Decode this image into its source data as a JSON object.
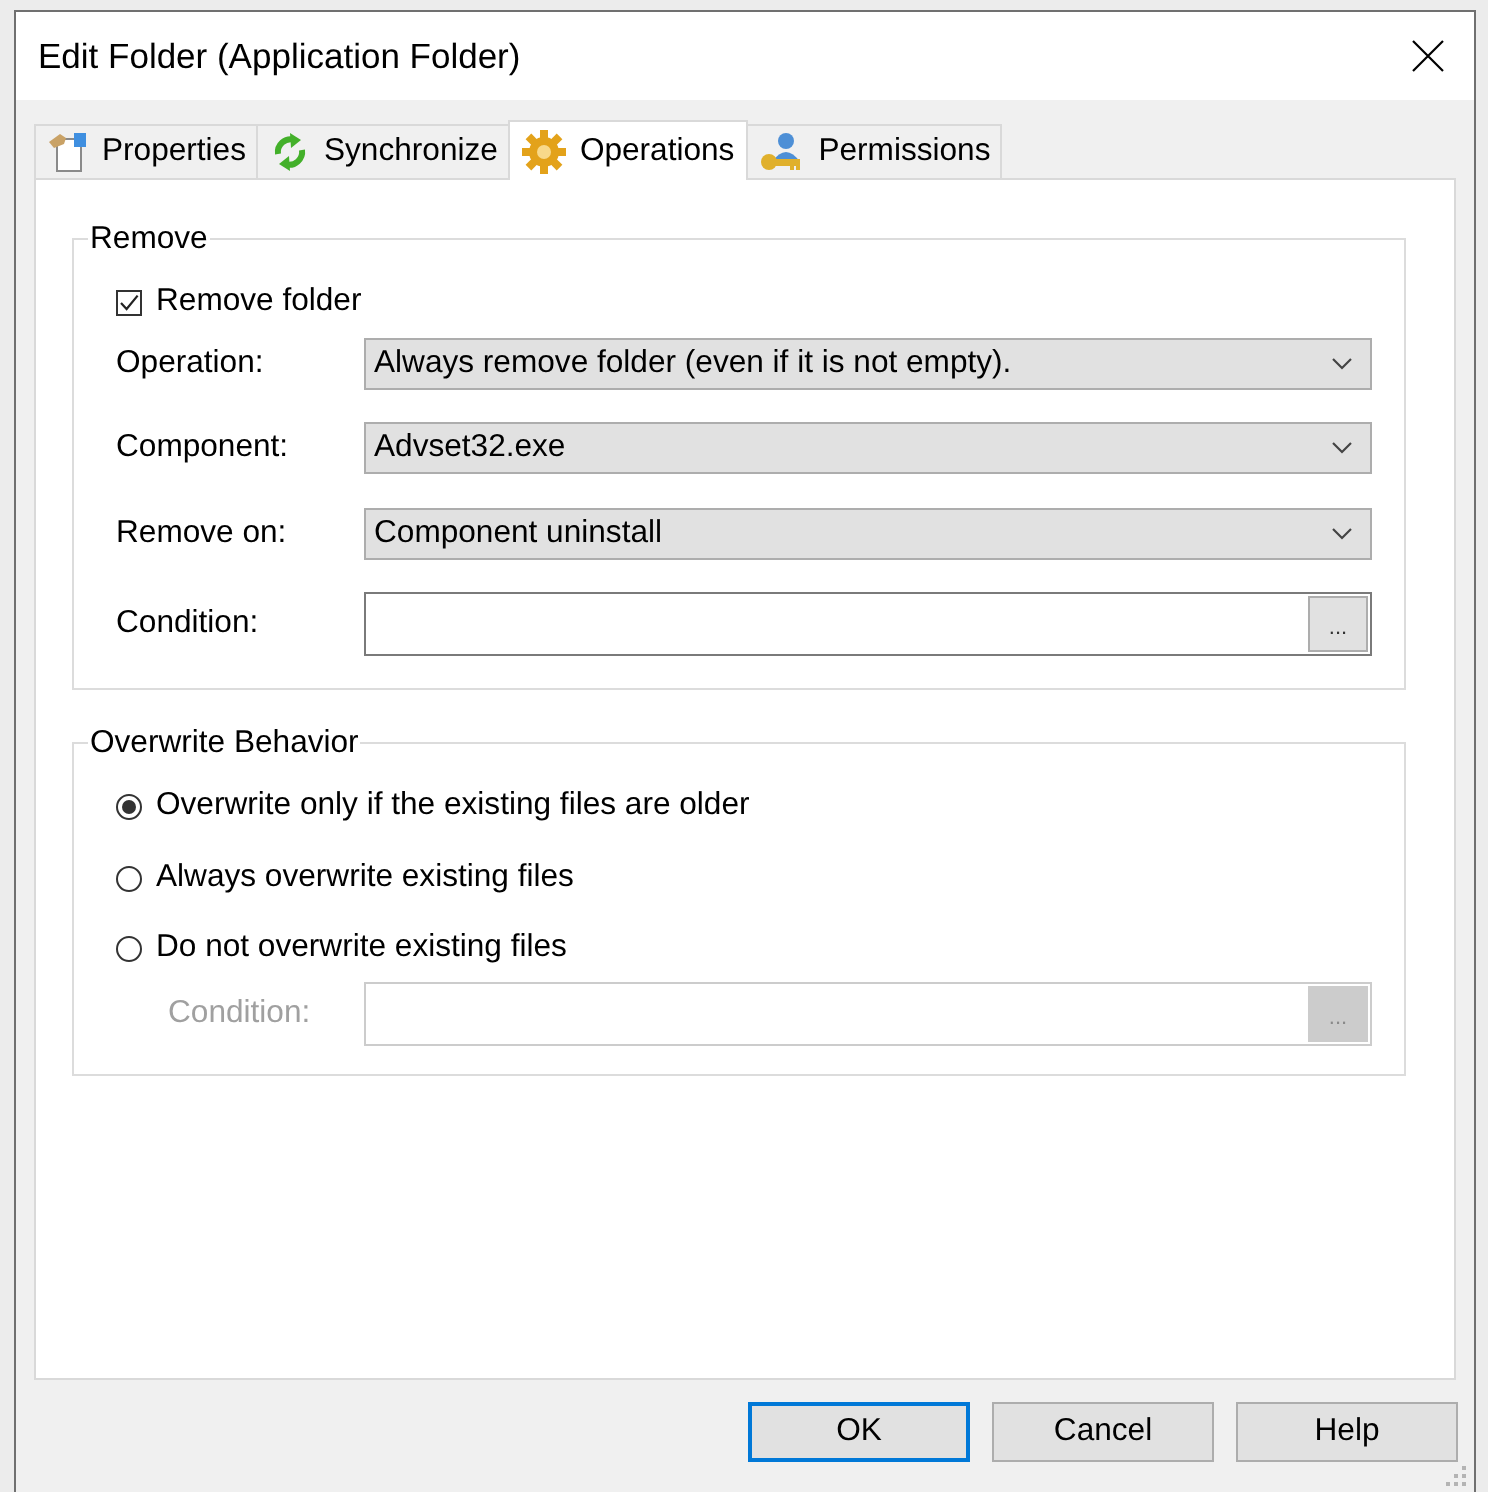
{
  "window": {
    "title": "Edit Folder (Application Folder)"
  },
  "tabs": [
    {
      "label": "Properties",
      "selected": false
    },
    {
      "label": "Synchronize",
      "selected": false
    },
    {
      "label": "Operations",
      "selected": true
    },
    {
      "label": "Permissions",
      "selected": false
    }
  ],
  "remove": {
    "title": "Remove",
    "remove_folder": {
      "label": "Remove folder",
      "checked": true
    },
    "fields": [
      {
        "kind": "dropdown",
        "label": "Operation:",
        "value": "Always remove folder (even if it is not empty)."
      },
      {
        "kind": "dropdown",
        "label": "Component:",
        "value": "Advset32.exe"
      },
      {
        "kind": "dropdown",
        "label": "Remove on:",
        "value": "Component uninstall"
      },
      {
        "kind": "text",
        "label": "Condition:",
        "button": "..."
      }
    ]
  },
  "overwrite_behavior": {
    "title": "Overwrite Behavior",
    "options": [
      {
        "label": "Overwrite only if the existing files are older",
        "selected": true
      },
      {
        "label": "Always overwrite existing files",
        "selected": false
      },
      {
        "label": "Do not overwrite existing files",
        "selected": false
      }
    ],
    "condition": {
      "label": "Condition:",
      "disabled": true,
      "button": "..."
    }
  },
  "buttons": [
    {
      "label": "OK",
      "default": true
    },
    {
      "label": "Cancel",
      "default": false
    },
    {
      "label": "Help",
      "default": false
    }
  ]
}
